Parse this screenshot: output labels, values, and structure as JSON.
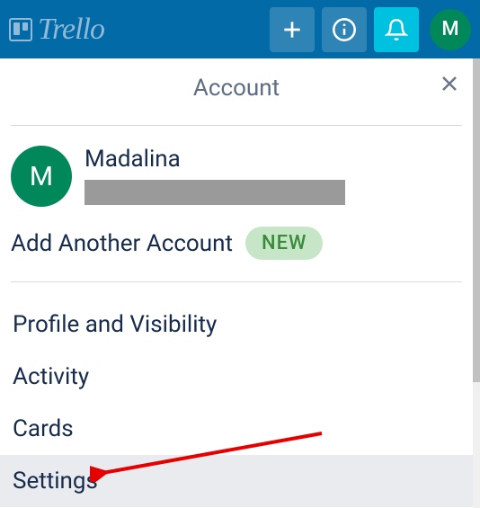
{
  "app": {
    "name": "Trello"
  },
  "topbar": {
    "avatar_initial": "M"
  },
  "panel": {
    "title": "Account",
    "account": {
      "avatar_initial": "M",
      "name": "Madalina"
    },
    "add_account_label": "Add Another Account",
    "add_account_badge": "NEW",
    "menu": {
      "profile": "Profile and Visibility",
      "activity": "Activity",
      "cards": "Cards",
      "settings": "Settings"
    }
  }
}
